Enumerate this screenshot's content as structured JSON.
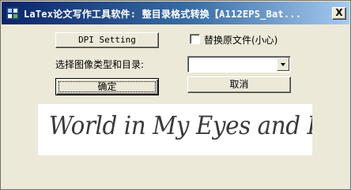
{
  "window": {
    "title": "LaTex论文写作工具软件: 整目录格式转换【A112EPS_Bat...",
    "close_glyph": "X"
  },
  "controls": {
    "dpi_button_label": "DPI Setting",
    "replace_checkbox_label": "替换原文件(小心)",
    "replace_checkbox_checked": false,
    "select_label": "选择图像类型和目录:",
    "image_type_value": "",
    "ok_button_label": "确定",
    "cancel_button_label": "取消"
  },
  "banner": {
    "text": "World in My Eyes and Brain"
  },
  "colors": {
    "face": "#ece9d8",
    "title_start": "#0a246a",
    "title_end": "#a6caf0",
    "banner_bg": "#ffffff"
  }
}
